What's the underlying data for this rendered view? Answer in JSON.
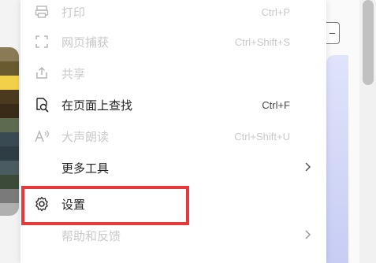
{
  "menu": {
    "items": [
      {
        "id": "print",
        "label": "打印",
        "shortcut": "Ctrl+P",
        "icon": "printer-icon",
        "faded": true,
        "submenu": false
      },
      {
        "id": "screenshot",
        "label": "网页捕获",
        "shortcut": "Ctrl+Shift+S",
        "icon": "screenshot-icon",
        "faded": true,
        "submenu": false
      },
      {
        "id": "share",
        "label": "共享",
        "shortcut": "",
        "icon": "share-icon",
        "faded": true,
        "submenu": false
      },
      {
        "id": "find",
        "label": "在页面上查找",
        "shortcut": "Ctrl+F",
        "icon": "find-icon",
        "faded": false,
        "submenu": false
      },
      {
        "id": "read-aloud",
        "label": "大声朗读",
        "shortcut": "Ctrl+Shift+U",
        "icon": "read-aloud-icon",
        "faded": true,
        "submenu": false
      },
      {
        "id": "more-tools",
        "label": "更多工具",
        "shortcut": "",
        "icon": "",
        "faded": false,
        "submenu": true
      },
      {
        "id": "settings",
        "label": "设置",
        "shortcut": "",
        "icon": "gear-icon",
        "faded": false,
        "submenu": false
      },
      {
        "id": "help",
        "label": "帮助和反馈",
        "shortcut": "",
        "icon": "",
        "faded": true,
        "submenu": true
      }
    ]
  },
  "colors": {
    "highlight": "#e63a3a",
    "card_gradient_top": "#dfe4fb",
    "card_gradient_bottom": "#c7cdf4"
  },
  "background": {
    "side_button_symbol": "−"
  }
}
